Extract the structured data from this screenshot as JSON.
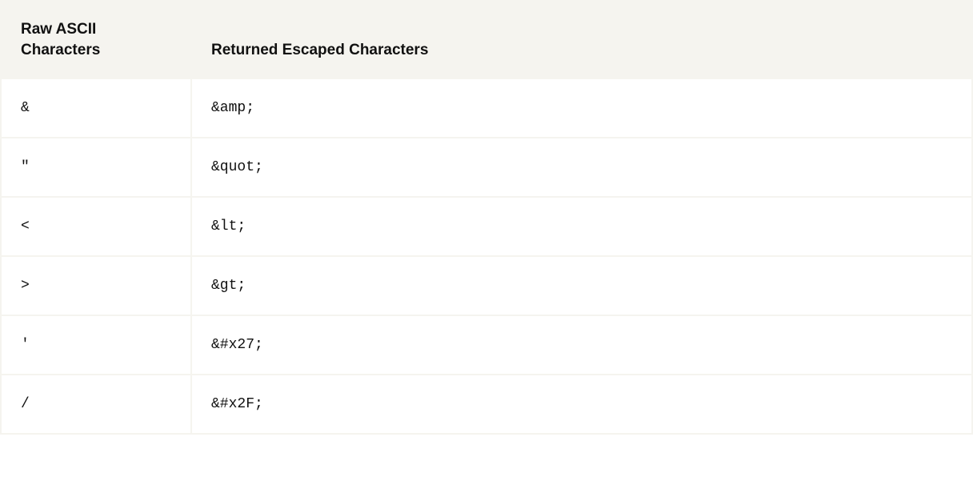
{
  "table": {
    "headers": {
      "left": "Raw ASCII Characters",
      "right": "Returned Escaped Characters"
    },
    "rows": [
      {
        "raw": "&",
        "escaped": "&amp;"
      },
      {
        "raw": "\"",
        "escaped": "&quot;"
      },
      {
        "raw": "<",
        "escaped": "&lt;"
      },
      {
        "raw": ">",
        "escaped": "&gt;"
      },
      {
        "raw": "'",
        "escaped": "&#x27;"
      },
      {
        "raw": "/",
        "escaped": "&#x2F;"
      }
    ]
  }
}
